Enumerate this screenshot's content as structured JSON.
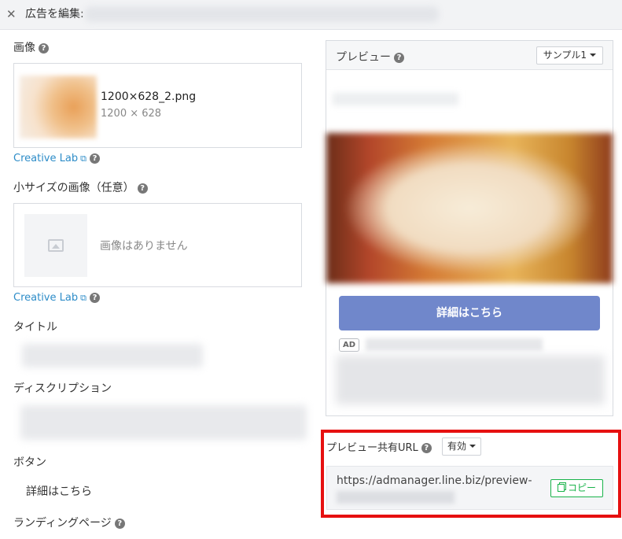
{
  "header": {
    "close_icon": "close-icon",
    "title": "広告を編集:"
  },
  "form": {
    "image_label": "画像",
    "image_file_name": "1200×628_2.png",
    "image_file_size": "1200 × 628",
    "creative_lab_1": "Creative Lab",
    "small_image_label": "小サイズの画像（任意）",
    "no_image_text": "画像はありません",
    "creative_lab_2": "Creative Lab",
    "title_label": "タイトル",
    "description_label": "ディスクリプション",
    "button_label": "ボタン",
    "button_value": "詳細はこちら",
    "landing_page_label": "ランディングページ"
  },
  "preview": {
    "title": "プレビュー",
    "sample_select": "サンプル1",
    "cta_label": "詳細はこちら",
    "ad_badge": "AD"
  },
  "share": {
    "label": "プレビュー共有URL",
    "status_select": "有効",
    "url": "https://admanager.line.biz/preview-",
    "copy_label": "コピー",
    "highlight_color": "#e61010"
  },
  "colors": {
    "link": "#2d8cc8",
    "cta": "#7087cb",
    "copy": "#19b34a"
  }
}
